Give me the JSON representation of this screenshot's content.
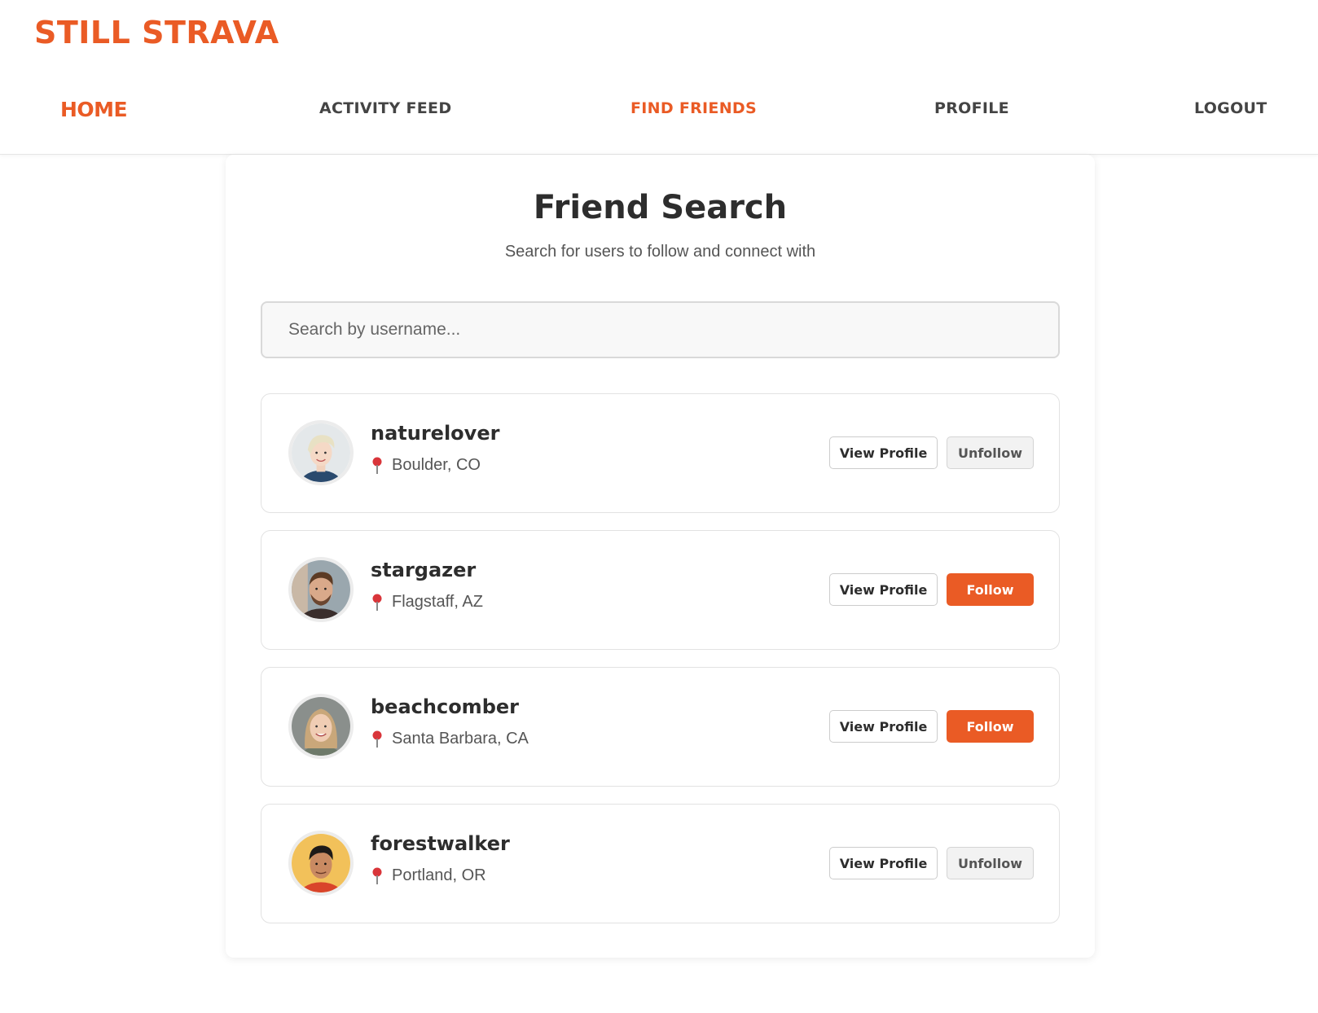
{
  "brand": {
    "logo_text": "STILL STRAVA",
    "accent_color": "#ea5b25"
  },
  "nav": {
    "home": "HOME",
    "activity_feed": "ACTIVITY FEED",
    "find_friends": "FIND FRIENDS",
    "profile": "PROFILE",
    "logout": "LOGOUT",
    "active": "find_friends"
  },
  "page": {
    "title": "Friend Search",
    "subtitle": "Search for users to follow and connect with"
  },
  "search": {
    "placeholder": "Search by username...",
    "value": ""
  },
  "users": [
    {
      "username": "naturelover",
      "location": "Boulder, CO",
      "view_label": "View Profile",
      "action_label": "Unfollow",
      "following": true
    },
    {
      "username": "stargazer",
      "location": "Flagstaff, AZ",
      "view_label": "View Profile",
      "action_label": "Follow",
      "following": false
    },
    {
      "username": "beachcomber",
      "location": "Santa Barbara, CA",
      "view_label": "View Profile",
      "action_label": "Follow",
      "following": false
    },
    {
      "username": "forestwalker",
      "location": "Portland, OR",
      "view_label": "View Profile",
      "action_label": "Unfollow",
      "following": true
    }
  ]
}
